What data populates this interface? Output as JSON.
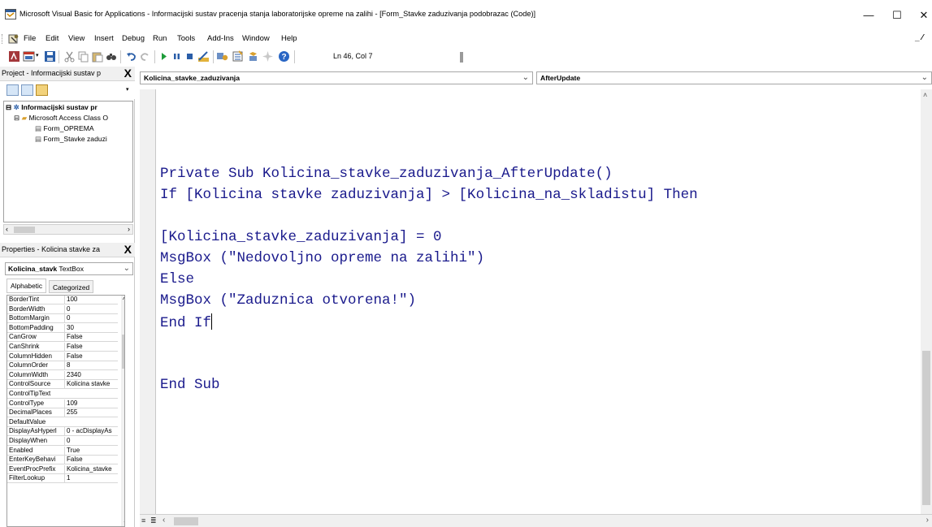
{
  "window": {
    "title": "Microsoft Visual Basic for Applications - Informacijski sustav pracenja stanja laboratorijske opreme na zalihi - [Form_Stavke zaduzivanja podobrazac (Code)]",
    "minimize": "—",
    "maximize": "☐",
    "close": "✕"
  },
  "menu": {
    "items": [
      "File",
      "Edit",
      "View",
      "Insert",
      "Debug",
      "Run",
      "Tools",
      "Add-Ins",
      "Window",
      "Help"
    ],
    "mdi_controls": "_ ⁄"
  },
  "toolbar": {
    "position": "Ln 46, Col 7"
  },
  "project_pane": {
    "title": "Project - Informacijski sustav p",
    "close": "X",
    "tree": {
      "root": "Informacijski sustav pr",
      "folder": "Microsoft Access Class O",
      "items": [
        "Form_OPREMA",
        "Form_Stavke zaduzi"
      ]
    }
  },
  "properties_pane": {
    "title": "Properties - Kolicina stavke za",
    "close": "X",
    "object_name": "Kolicina_stavk",
    "object_type": "TextBox",
    "tabs": [
      "Alphabetic",
      "Categorized"
    ],
    "rows": [
      {
        "name": "BorderTint",
        "value": "100"
      },
      {
        "name": "BorderWidth",
        "value": "0"
      },
      {
        "name": "BottomMargin",
        "value": "0"
      },
      {
        "name": "BottomPadding",
        "value": "30"
      },
      {
        "name": "CanGrow",
        "value": "False"
      },
      {
        "name": "CanShrink",
        "value": "False"
      },
      {
        "name": "ColumnHidden",
        "value": "False"
      },
      {
        "name": "ColumnOrder",
        "value": "8"
      },
      {
        "name": "ColumnWidth",
        "value": "2340"
      },
      {
        "name": "ControlSource",
        "value": "Kolicina stavke"
      },
      {
        "name": "ControlTipText",
        "value": ""
      },
      {
        "name": "ControlType",
        "value": "109"
      },
      {
        "name": "DecimalPlaces",
        "value": "255"
      },
      {
        "name": "DefaultValue",
        "value": ""
      },
      {
        "name": "DisplayAsHyperl",
        "value": "0 - acDisplayAs"
      },
      {
        "name": "DisplayWhen",
        "value": "0"
      },
      {
        "name": "Enabled",
        "value": "True"
      },
      {
        "name": "EnterKeyBehavi",
        "value": "False"
      },
      {
        "name": "EventProcPrefix",
        "value": "Kolicina_stavke"
      },
      {
        "name": "FilterLookup",
        "value": "1"
      }
    ]
  },
  "code_window": {
    "object_combo": "Kolicina_stavke_zaduzivanja",
    "procedure_combo": "AfterUpdate",
    "lines": [
      "Private Sub Kolicina_stavke_zaduzivanja_AfterUpdate()",
      "If [Kolicina stavke zaduzivanja] > [Kolicina_na_skladistu] Then",
      "",
      "[Kolicina_stavke_zaduzivanja] = 0",
      "MsgBox (\"Nedovoljno opreme na zalihi\")",
      "Else",
      "MsgBox (\"Zaduznica otvorena!\")",
      "End If",
      "",
      "",
      "End Sub"
    ]
  },
  "colors": {
    "code_text": "#1a1a8c",
    "chrome": "#f0f0f0"
  }
}
